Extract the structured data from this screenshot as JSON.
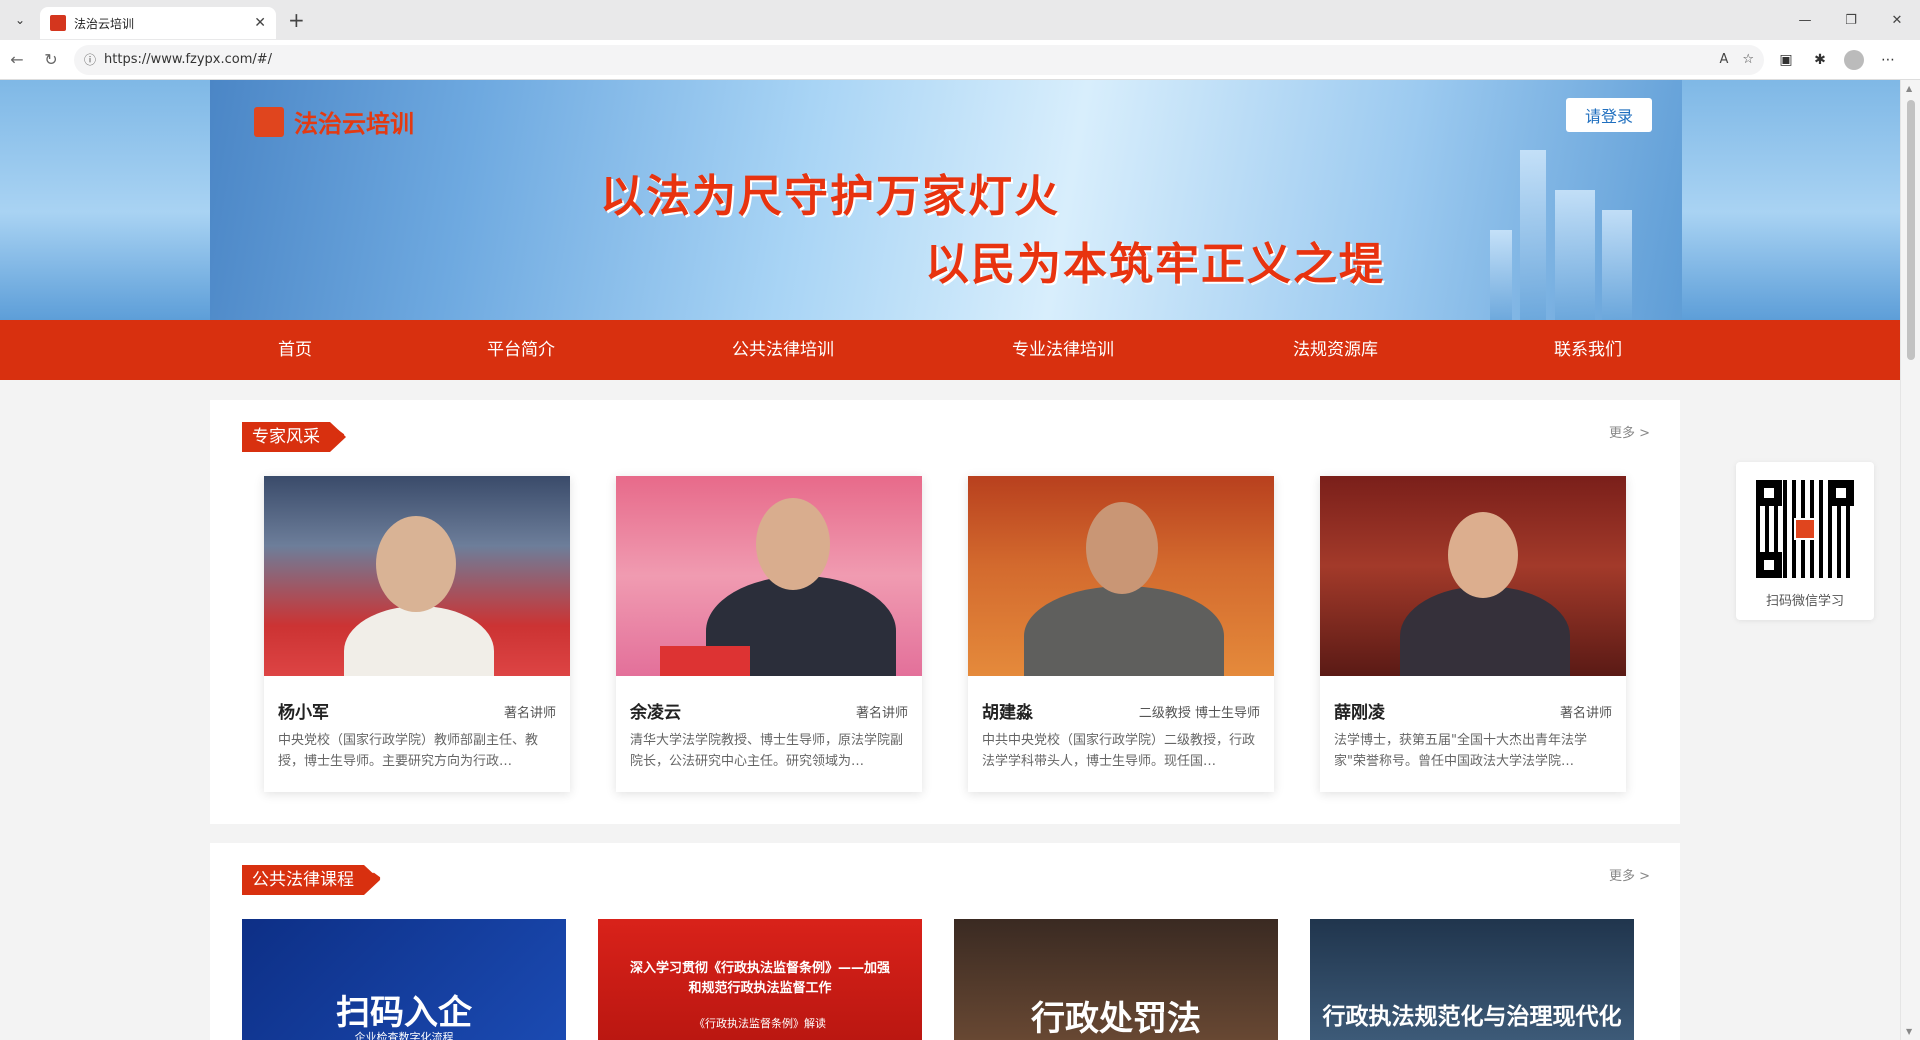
{
  "browser": {
    "tab_title": "法治云培训",
    "url": "https://www.fzypx.com/#/",
    "tab_close": "✕",
    "new_tab": "+"
  },
  "site": {
    "logo_text": "法治云培训",
    "logo_seal": "",
    "login_label": "请登录",
    "slogan_line1": "以法为尺守护万家灯火",
    "slogan_line2": "以民为本筑牢正义之堤"
  },
  "nav": {
    "items": [
      {
        "label": "首页"
      },
      {
        "label": "平台简介"
      },
      {
        "label": "公共法律培训"
      },
      {
        "label": "专业法律培训"
      },
      {
        "label": "法规资源库"
      },
      {
        "label": "联系我们"
      }
    ]
  },
  "experts": {
    "section_title": "专家风采",
    "more_label": "更多 >",
    "cards": [
      {
        "name": "杨小军",
        "title": "著名讲师",
        "desc": "中央党校（国家行政学院）教师部副主任、教授，博士生导师。主要研究方向为行政…"
      },
      {
        "name": "余凌云",
        "title": "著名讲师",
        "desc": "清华大学法学院教授、博士生导师，原法学院副院长，公法研究中心主任。研究领域为…"
      },
      {
        "name": "胡建淼",
        "title": "二级教授 博士生导师",
        "desc": "中共中央党校（国家行政学院）二级教授，行政法学学科带头人，博士生导师。现任国…"
      },
      {
        "name": "薛刚凌",
        "title": "著名讲师",
        "desc": "法学博士，获第五届\"全国十大杰出青年法学家\"荣誉称号。曾任中国政法大学法学院…"
      }
    ]
  },
  "public_courses": {
    "section_title": "公共法律课程",
    "more_label": "更多 >",
    "cards": [
      {
        "text": "扫码入企",
        "subtext": "企业检查数字化流程"
      },
      {
        "text": "深入学习贯彻《行政执法监督条例》——加强和规范行政执法监督工作",
        "subtext": "《行政执法监督条例》解读"
      },
      {
        "text": "行政处罚法",
        "subtext": ""
      },
      {
        "text": "行政执法规范化与治理现代化",
        "subtext": ""
      }
    ]
  },
  "qr": {
    "label": "扫码微信学习"
  },
  "colors": {
    "brand_red": "#d8300f",
    "login_text": "#1f6fbf"
  }
}
